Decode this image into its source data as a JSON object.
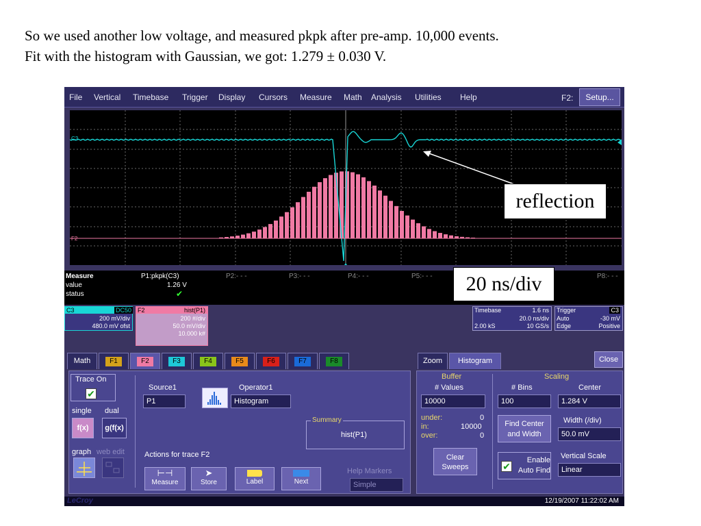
{
  "slide": {
    "line1": "So we used another low voltage, and measured pkpk after pre-amp. 10,000 events.",
    "line2": "Fit with the histogram with Gaussian, we  got: 1.279 ± 0.030 V."
  },
  "menu": {
    "items": [
      "File",
      "Vertical",
      "Timebase",
      "Trigger",
      "Display",
      "Cursors",
      "Measure",
      "Math",
      "Analysis",
      "Utilities",
      "Help"
    ],
    "f2_label": "F2:",
    "setup_label": "Setup..."
  },
  "grid": {
    "c3_label": "C3",
    "f2_label": "F2",
    "trace_color": "#19d6d6",
    "hist_color": "#f07aa4"
  },
  "measure": {
    "title": "Measure",
    "value_label": "value",
    "status_label": "status",
    "p1_header": "P1:pkpk(C3)",
    "p1_value": "1.26 V",
    "p2": "P2:- - -",
    "p3": "P3:- - -",
    "p4": "P4:- - -",
    "p5": "P5:- - -",
    "p8": "P8:- - -"
  },
  "c3_card": {
    "name": "C3",
    "coupling": "DC50",
    "vdiv": "200 mV/div",
    "offset": "480.0 mV ofst"
  },
  "f2_card": {
    "name": "F2",
    "func": "hist(P1)",
    "line1": "200 #/div",
    "line2": "50.0 mV/div",
    "line3": "10.000 k#"
  },
  "timebase": {
    "label": "Timebase",
    "value": "1.6 ns",
    "div": "20.0 ns/div",
    "samples": "2.00 kS",
    "rate": "10 GS/s"
  },
  "trigger": {
    "label": "Trigger",
    "source": "C3",
    "mode": "Auto",
    "level": "-30 mV",
    "type": "Edge",
    "slope": "Positive"
  },
  "tabs": {
    "math": "Math",
    "f_tabs": [
      "F1",
      "F2",
      "F3",
      "F4",
      "F5",
      "F6",
      "F7",
      "F8"
    ],
    "zoom": "Zoom",
    "histogram": "Histogram",
    "close": "Close"
  },
  "f2_panel": {
    "trace_on": "Trace On",
    "single": "single",
    "dual": "dual",
    "fx": "f(x)",
    "gfx": "g(f(x)",
    "graph": "graph",
    "web_edit": "web edit",
    "source1_label": "Source1",
    "source1_value": "P1",
    "operator1_label": "Operator1",
    "operator1_value": "Histogram",
    "summary_label": "Summary",
    "summary_value": "hist(P1)",
    "actions_label": "Actions for trace F2",
    "actions": [
      "Measure",
      "Store",
      "Label",
      "Next"
    ],
    "help_markers_label": "Help Markers",
    "help_markers_value": "Simple"
  },
  "hist_panel": {
    "buffer_label": "Buffer",
    "values_label": "# Values",
    "values": "10000",
    "under_label": "under:",
    "under": "0",
    "in_label": "in:",
    "in": "10000",
    "over_label": "over:",
    "over": "0",
    "clear_sweeps": "Clear Sweeps",
    "scaling_label": "Scaling",
    "bins_label": "# Bins",
    "bins": "100",
    "center_label": "Center",
    "center": "1.284 V",
    "find_center": "Find Center and Width",
    "width_label": "Width (/div)",
    "width": "50.0 mV",
    "enable_auto_find": "Enable Auto Find",
    "vscale_label": "Vertical Scale",
    "vscale": "Linear"
  },
  "statusbar": {
    "brand": "LeCroy",
    "datetime": "12/19/2007 11:22:02 AM"
  },
  "annotations": {
    "reflection": "reflection",
    "ns_div": "20 ns/div"
  }
}
